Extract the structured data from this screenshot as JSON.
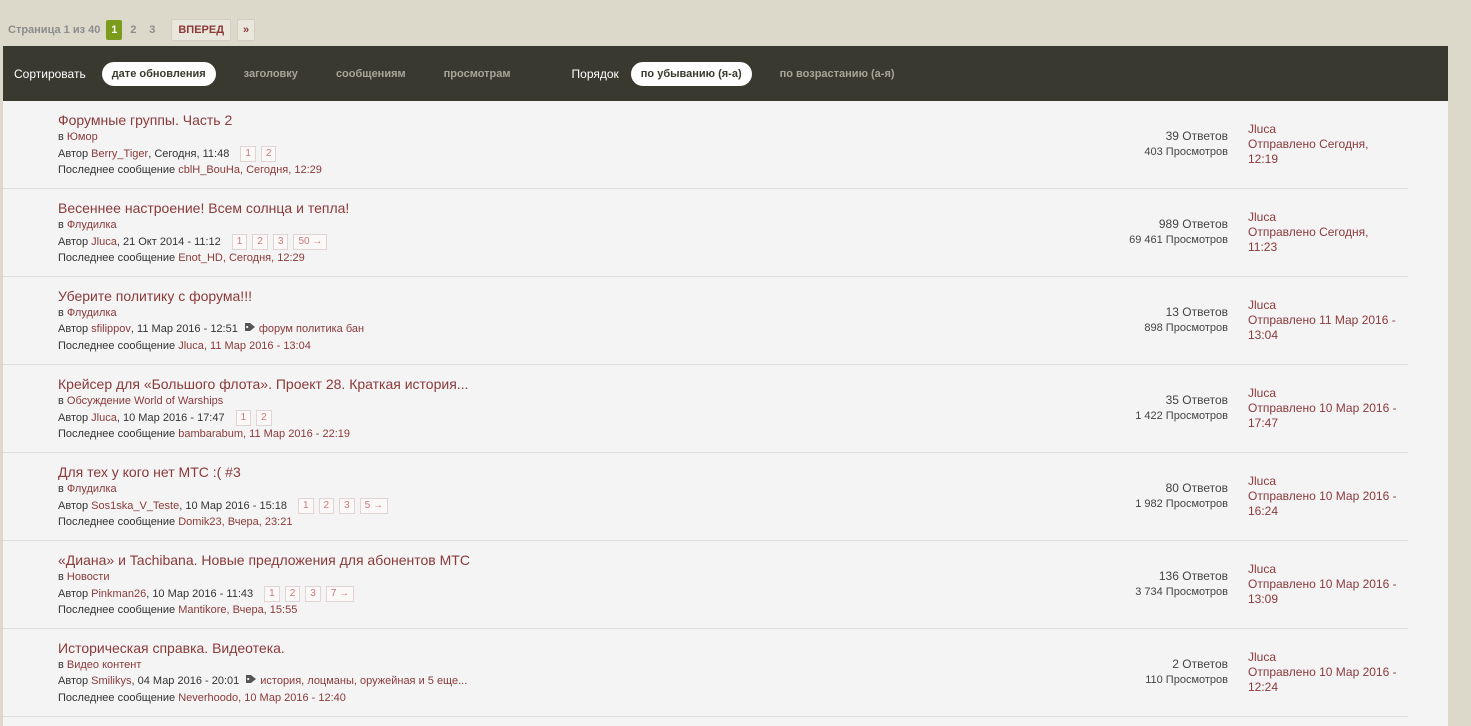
{
  "pager": {
    "label": "Страница 1 из 40",
    "pages": [
      "1",
      "2",
      "3"
    ],
    "next": "ВПЕРЕД",
    "last": "»"
  },
  "sort": {
    "label": "Сортировать",
    "options": [
      "дате обновления",
      "заголовку",
      "сообщениям",
      "просмотрам"
    ],
    "order_label": "Порядок",
    "order_options": [
      "по убыванию (я-а)",
      "по возрастанию (а-я)"
    ]
  },
  "labels": {
    "in": "в",
    "author": "Автор",
    "last_post": "Последнее сообщение",
    "replies_suffix": "Ответов",
    "views_suffix": "Просмотров"
  },
  "colors": {
    "link": "#8b3a3a",
    "sortbar_bg": "#393930",
    "pager_active": "#7a9b1c",
    "page_bg": "#dcd9cb"
  },
  "topics": [
    {
      "title": "Форумные группы. Часть 2",
      "forum": "Юмор",
      "author": "Berry_Tiger",
      "date": ", Сегодня, 11:48",
      "pages": [
        "1",
        "2"
      ],
      "tags": "",
      "last_author": "cblH_BouHa",
      "last_date": "Сегодня, 12:29",
      "replies": "39 Ответов",
      "views": "403 Просмотров",
      "lp_author": "Jluca",
      "lp_line1": "Отправлено Сегодня,",
      "lp_line2": "12:19"
    },
    {
      "title": "Весеннее настроение! Всем солнца и тепла!",
      "forum": "Флудилка",
      "author": "Jluca",
      "date": ", 21 Окт 2014 - 11:12",
      "pages": [
        "1",
        "2",
        "3",
        "50 →"
      ],
      "tags": "",
      "last_author": "Enot_HD",
      "last_date": "Сегодня, 12:29",
      "replies": "989 Ответов",
      "views": "69  461 Просмотров",
      "lp_author": "Jluca",
      "lp_line1": "Отправлено Сегодня,",
      "lp_line2": "11:23"
    },
    {
      "title": "Уберите политику с форума!!!",
      "forum": "Флудилка",
      "author": "sfilippov",
      "date": ", 11 Мар 2016 - 12:51",
      "pages": [],
      "tags": "форум политика бан",
      "last_author": "Jluca",
      "last_date": "11 Мар 2016 - 13:04",
      "replies": "13 Ответов",
      "views": "898 Просмотров",
      "lp_author": "Jluca",
      "lp_line1": "Отправлено 11 Мар 2016 -",
      "lp_line2": "13:04"
    },
    {
      "title": "Крейсер для «Большого флота». Проект 28. Краткая история...",
      "forum": "Обсуждение World of Warships",
      "author": "Jluca",
      "date": ", 10 Мар 2016 - 17:47",
      "pages": [
        "1",
        "2"
      ],
      "tags": "",
      "last_author": "bambarabum",
      "last_date": "11 Мар 2016 - 22:19",
      "replies": "35 Ответов",
      "views": "1  422 Просмотров",
      "lp_author": "Jluca",
      "lp_line1": "Отправлено 10 Мар 2016 -",
      "lp_line2": "17:47"
    },
    {
      "title": "Для тех у кого нет МТС :( #3",
      "forum": "Флудилка",
      "author": "Sos1ska_V_Teste",
      "date": ", 10 Мар 2016 - 15:18",
      "pages": [
        "1",
        "2",
        "3",
        "5 →"
      ],
      "tags": "",
      "last_author": "Domik23",
      "last_date": "Вчера, 23:21",
      "replies": "80 Ответов",
      "views": "1  982 Просмотров",
      "lp_author": "Jluca",
      "lp_line1": "Отправлено 10 Мар 2016 -",
      "lp_line2": "16:24"
    },
    {
      "title": "«Диана» и Tachibana. Новые предложения для абонентов МТС",
      "forum": "Новости",
      "author": "Pinkman26",
      "date": ", 10 Мар 2016 - 11:43",
      "pages": [
        "1",
        "2",
        "3",
        "7 →"
      ],
      "tags": "",
      "last_author": "Mantikore",
      "last_date": "Вчера, 15:55",
      "replies": "136 Ответов",
      "views": "3  734 Просмотров",
      "lp_author": "Jluca",
      "lp_line1": "Отправлено 10 Мар 2016 -",
      "lp_line2": "13:09"
    },
    {
      "title": "Историческая справка. Видеотека.",
      "forum": "Видео контент",
      "author": "Smilikys",
      "date": ", 04 Мар 2016 - 20:01",
      "pages": [],
      "tags": "история, лоцманы, оружейная и 5 еще...",
      "last_author": "Neverhoodo",
      "last_date": "10 Мар 2016 - 12:40",
      "replies": "2 Ответов",
      "views": "110 Просмотров",
      "lp_author": "Jluca",
      "lp_line1": "Отправлено 10 Мар 2016 -",
      "lp_line2": "12:24"
    }
  ]
}
